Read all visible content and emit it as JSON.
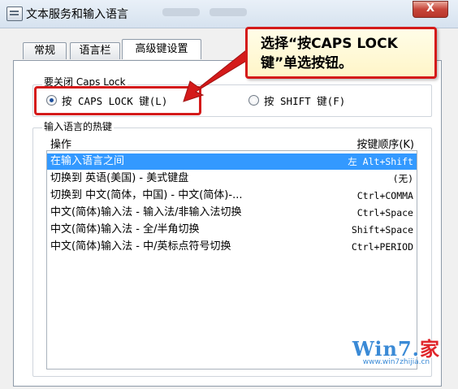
{
  "window": {
    "title": "文本服务和输入语言",
    "close_label": "X"
  },
  "tabs": [
    {
      "label": "常规",
      "active": false
    },
    {
      "label": "语言栏",
      "active": false
    },
    {
      "label": "高级键设置",
      "active": true
    }
  ],
  "caps_lock_group": {
    "label": "要关闭 Caps Lock",
    "options": [
      {
        "label": "按 CAPS LOCK 键(L)",
        "selected": true
      },
      {
        "label": "按 SHIFT 键(F)",
        "selected": false
      }
    ]
  },
  "hotkeys_group": {
    "label": "输入语言的热键",
    "columns": {
      "operation": "操作",
      "key_sequence": "按键顺序(K)"
    },
    "rows": [
      {
        "operation": "在输入语言之间",
        "key": "左 Alt+Shift",
        "selected": true
      },
      {
        "operation": "切换到 英语(美国) - 美式键盘",
        "key": "(无)",
        "selected": false
      },
      {
        "operation": "切换到 中文(简体，中国) - 中文(简体)-...",
        "key": "Ctrl+COMMA",
        "selected": false
      },
      {
        "operation": "中文(简体)输入法 - 输入法/非输入法切换",
        "key": "Ctrl+Space",
        "selected": false
      },
      {
        "operation": "中文(简体)输入法 - 全/半角切换",
        "key": "Shift+Space",
        "selected": false
      },
      {
        "operation": "中文(简体)输入法 - 中/英标点符号切换",
        "key": "Ctrl+PERIOD",
        "selected": false
      }
    ]
  },
  "callout": {
    "text": "选择“按CAPS LOCK键”单选按钮。"
  },
  "watermark": {
    "main_a": "Win7.",
    "main_b": "家",
    "sub": "www.win7zhijia.cn"
  },
  "colors": {
    "annotation_red": "#d41a1a",
    "selection_blue": "#3399ff",
    "callout_bg": "#fff5c8"
  }
}
